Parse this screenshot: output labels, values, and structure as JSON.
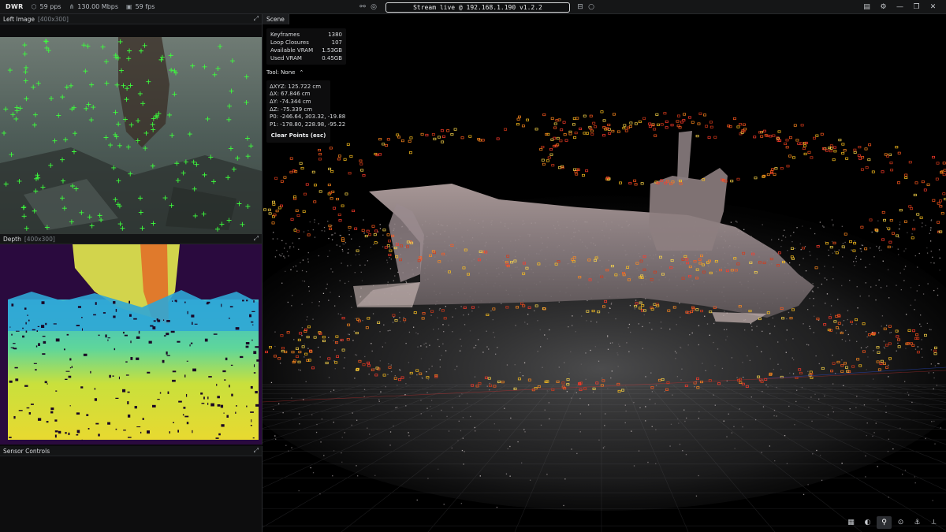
{
  "topbar": {
    "logo": "DWR",
    "pps": "59 pps",
    "bandwidth": "130.00 Mbps",
    "fps": "59 fps",
    "stream": "Stream live @ 192.168.1.190 v1.2.2"
  },
  "left_image": {
    "title": "Left Image",
    "size": "[400x300]"
  },
  "depth": {
    "title": "Depth",
    "size": "[400x300]"
  },
  "sensor": {
    "title": "Sensor Controls"
  },
  "scene": {
    "tab": "Scene",
    "stats": [
      {
        "label": "Keyframes",
        "value": "1380"
      },
      {
        "label": "Loop Closures",
        "value": "107"
      },
      {
        "label": "Available VRAM",
        "value": "1.53GB"
      },
      {
        "label": "Used VRAM",
        "value": "0.45GB"
      }
    ],
    "tool_label": "Tool: None",
    "measure": [
      "ΔXYZ: 125.722 cm",
      "ΔX: 67.846 cm",
      "ΔY: -74.344 cm",
      "ΔZ: -75.339 cm",
      "P0: -246.64, 303.32, -19.88",
      "P1: -178.80, 228.98, -95.22"
    ],
    "clear_label": "Clear Points (esc)"
  },
  "icons": {
    "top_center": [
      "link-icon",
      "target-icon"
    ],
    "top_right": [
      "document-icon",
      "gear-icon",
      "minimize-icon",
      "restore-icon",
      "close-icon"
    ],
    "scene_tools": [
      "grid-icon",
      "palette-icon",
      "measure-icon",
      "crosshair-icon",
      "anchor-icon",
      "axes-icon"
    ]
  },
  "colors": {
    "accent_green": "#3cff3c",
    "bg": "#000000"
  }
}
